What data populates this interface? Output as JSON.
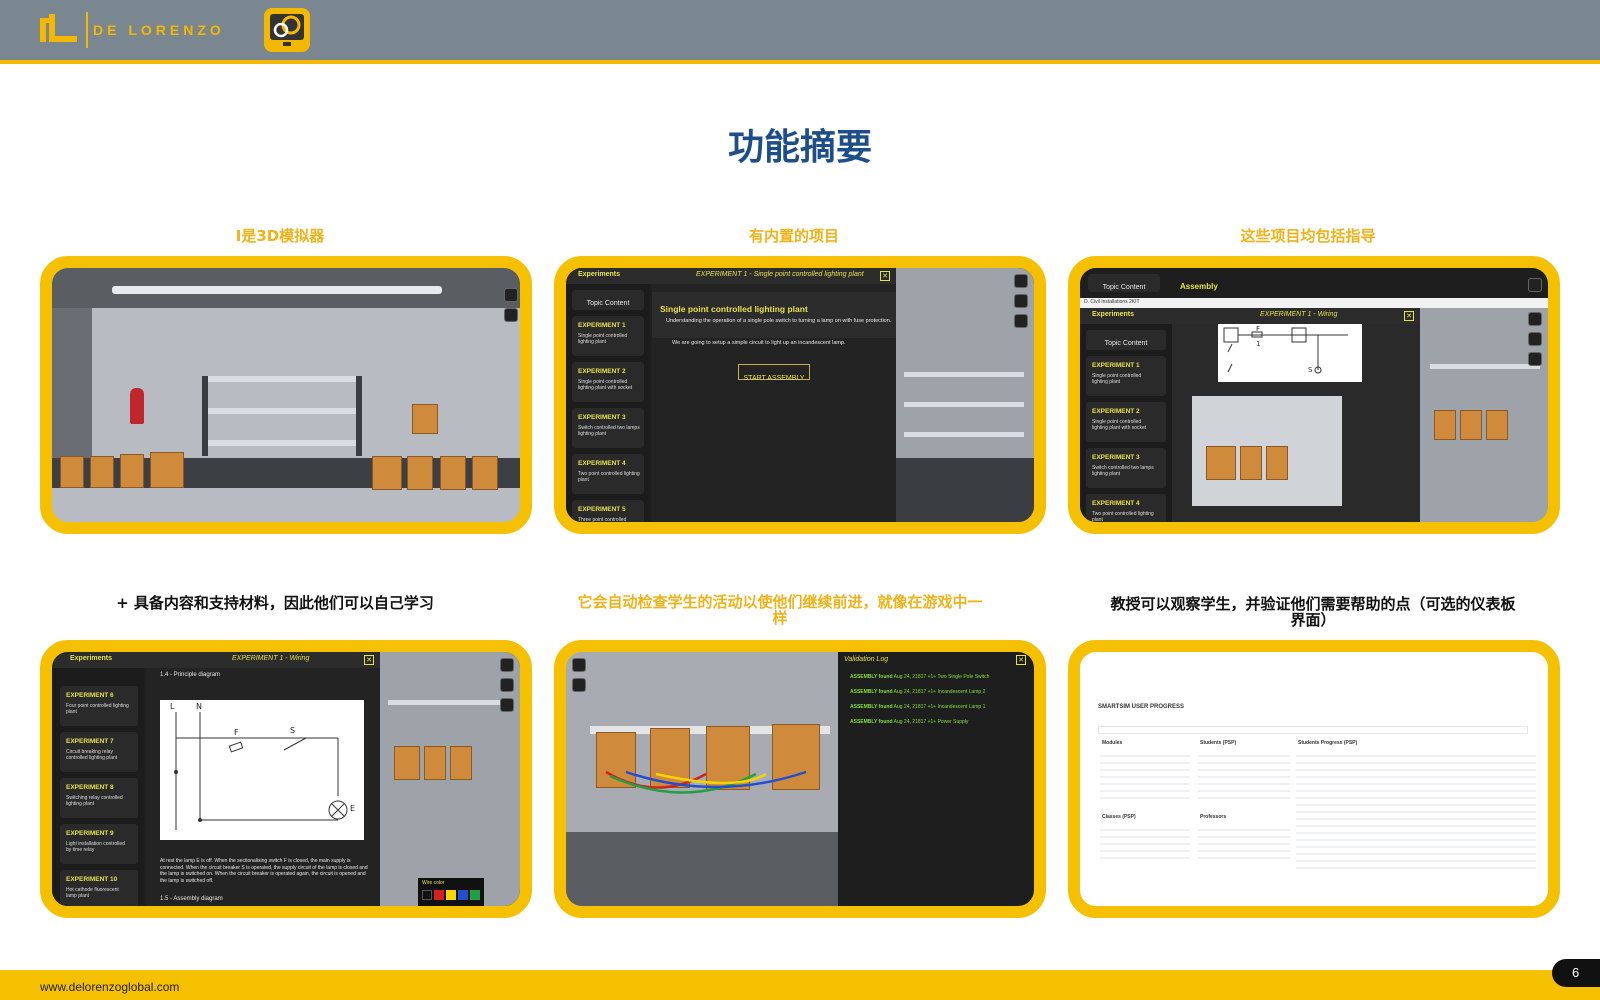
{
  "header": {
    "brand": "DE LORENZO",
    "logo_icon": "de-lorenzo-logo",
    "app_icon": "smartsim-gear-icon"
  },
  "title": "功能摘要",
  "captions": {
    "c1": "I是3D模拟器",
    "c2": "有内置的项目",
    "c3": "这些项目均包括指导",
    "c4": "+ 具备内容和支持材料，因此他们可以自己学习",
    "c5": "它会自动检查学生的活动以使他们继续前进，就像在游戏中一样",
    "c6": "教授可以观察学生，并验证他们需要帮助的点（可选的仪表板界面）"
  },
  "panel2": {
    "top_left": "Experiments",
    "top_title": "EXPERIMENT 1 - Single point controlled lighting plant",
    "topic_btn": "Topic Content",
    "heading": "Single point controlled lighting plant",
    "subheading": "Understanding the operation of a single pole switch to turning a lamp on with fuse protection.",
    "body": "We are going to setup a simple circuit to light up an incandescent lamp.",
    "start_btn": "START ASSEMBLY",
    "items": [
      {
        "title": "EXPERIMENT 1",
        "desc": "Single point controlled lighting plant"
      },
      {
        "title": "EXPERIMENT 2",
        "desc": "Single point controlled lighting plant with socket"
      },
      {
        "title": "EXPERIMENT 3",
        "desc": "Switch controlled two lamps lighting plant"
      },
      {
        "title": "EXPERIMENT 4",
        "desc": "Two point controlled lighting plant"
      },
      {
        "title": "EXPERIMENT 5",
        "desc": "Three point controlled"
      }
    ]
  },
  "panel3": {
    "topic_btn_top": "Topic Content",
    "assembly": "Assembly",
    "window_title": "D. Civil Installations 2KIT",
    "experiments": "Experiments",
    "wiring_title": "EXPERIMENT 1 - Wiring",
    "topic_btn": "Topic Content",
    "diagram_f": "F",
    "diagram_1": "1",
    "diagram_s": "S",
    "items": [
      {
        "title": "EXPERIMENT 1",
        "desc": "Single point controlled lighting plant"
      },
      {
        "title": "EXPERIMENT 2",
        "desc": "Single point controlled lighting plant with socket"
      },
      {
        "title": "EXPERIMENT 3",
        "desc": "Switch controlled two lamps lighting plant"
      },
      {
        "title": "EXPERIMENT 4",
        "desc": "Two point controlled lighting plant"
      }
    ]
  },
  "panel4": {
    "experiments": "Experiments",
    "wiring_title": "EXPERIMENT 1 - Wiring",
    "section1": "1.4 - Principle diagram",
    "label_l": "L",
    "label_n": "N",
    "label_f": "F",
    "label_s": "S",
    "label_e": "E",
    "desc": "At rest the lamp E is off. When the sectionalising switch F is closed, the main supply is connected. When the circuit breaker S is operated, the supply circuit of the lamp is closed and the lamp is switched on. When the circuit breaker is operated again, the circuit is opened and the lamp is switched off.",
    "section2": "1.5 - Assembly diagram",
    "wire_color": "Wire color",
    "items": [
      {
        "title": "EXPERIMENT 6",
        "desc": "Four point controlled lighting plant"
      },
      {
        "title": "EXPERIMENT 7",
        "desc": "Circuit breaking relay controlled lighting plant"
      },
      {
        "title": "EXPERIMENT 8",
        "desc": "Switching relay controlled lighting plant"
      },
      {
        "title": "EXPERIMENT 9",
        "desc": "Light installation controlled by time relay"
      },
      {
        "title": "EXPERIMENT 10",
        "desc": "Hot cathode fluorescent lamp plant"
      }
    ]
  },
  "panel5": {
    "log_title": "Validation Log",
    "entries": [
      {
        "tag": "ASSEMBLY found",
        "date": "Aug 24, 21817",
        "text": "+1+ Two Single Pole Switch"
      },
      {
        "tag": "ASSEMBLY found",
        "date": "Aug 24, 21817",
        "text": "+1+ Incandescent Lamp 2"
      },
      {
        "tag": "ASSEMBLY found",
        "date": "Aug 24, 21817",
        "text": "+1+ Incandescent Lamp 1"
      },
      {
        "tag": "ASSEMBLY found",
        "date": "Aug 24, 21817",
        "text": "+1+ Power Supply"
      }
    ]
  },
  "panel6": {
    "dash_title": "SMARTSIM USER PROGRESS",
    "col1_title": "Modules",
    "col2_title": "Students (PSP)",
    "col3_title": "Students Progress (PSP)",
    "col1b_title": "Classes (PSP)",
    "col2b_title": "Professors"
  },
  "footer": {
    "url": "www.delorenzoglobal.com",
    "page": "6"
  },
  "colors": {
    "accent": "#f5c000",
    "title": "#1d4e89",
    "header": "#7a8790"
  }
}
